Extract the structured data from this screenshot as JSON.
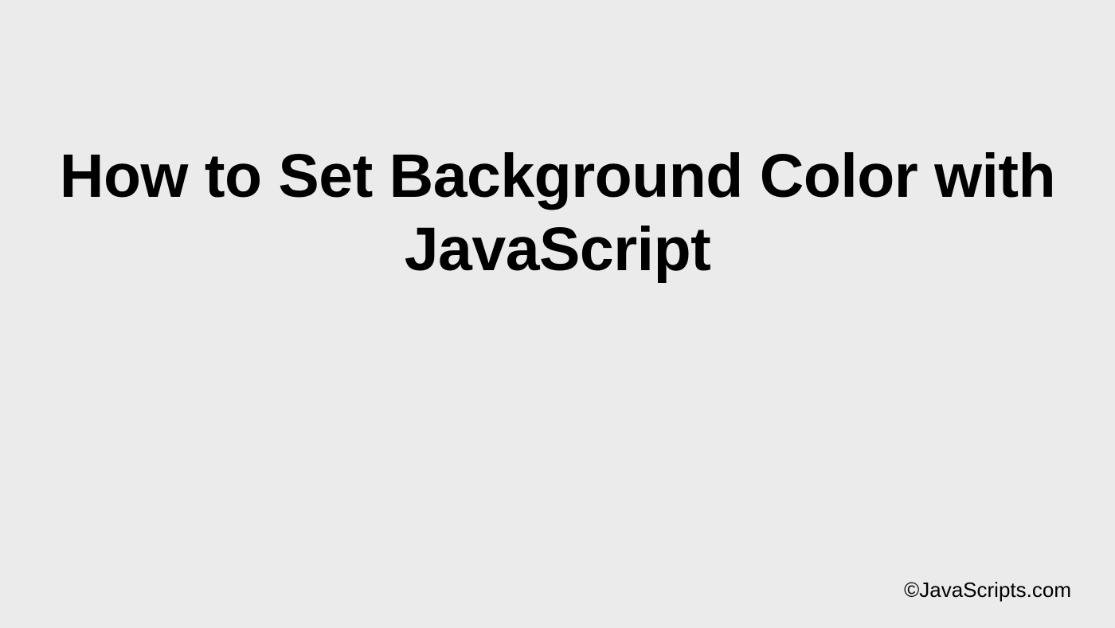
{
  "title": "How to Set Background Color with JavaScript",
  "attribution": "©JavaScripts.com"
}
